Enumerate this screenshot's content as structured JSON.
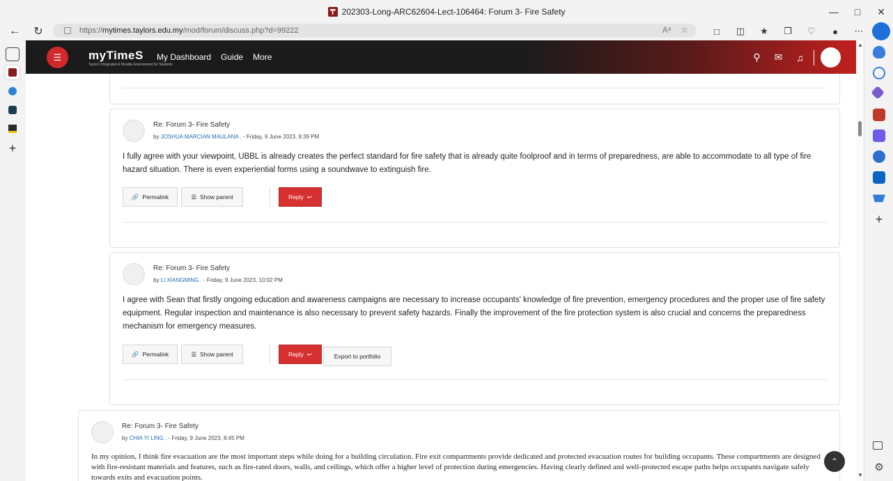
{
  "window": {
    "title": "202303-Long-ARC62604-Lect-106464: Forum 3- Fire Safety",
    "url_prefix": "https://",
    "url_host": "mytimes.taylors.edu.my",
    "url_path": "/mod/forum/discuss.php?d=99222"
  },
  "header": {
    "logo": "myTimeS",
    "logo_sub": "Taylor's Integrated & Moodle Environment for Students",
    "nav": [
      "My Dashboard",
      "Guide",
      "More"
    ]
  },
  "posts": [
    {
      "subject": "Re: Forum 3- Fire Safety",
      "by": "by",
      "author": "JOSHUA MARCIAN MAULANA",
      "date": " . - Friday, 9 June 2023, 9:39 PM",
      "content": "I fully agree with your viewpoint, UBBL is already creates the perfect standard for fire safety that is already quite foolproof and in terms of preparedness, are able to accommodate to all type of fire hazard situation. There is even experiential forms using a soundwave to extinguish fire.",
      "permalink": "Permalink",
      "show_parent": "Show parent",
      "reply": "Reply"
    },
    {
      "subject": "Re: Forum 3- Fire Safety",
      "by": "by",
      "author": "LI XIANGMING",
      "date": " . - Friday, 9 June 2023, 10:02 PM",
      "content": "I agree with Sean that firstly ongoing education and awareness campaigns are necessary to increase occupants' knowledge of fire prevention, emergency procedures and the proper use of fire safety equipment. Regular inspection and maintenance is also necessary to prevent safety hazards. Finally the improvement of the fire protection system is also crucial and concerns the preparedness mechanism for emergency measures.",
      "permalink": "Permalink",
      "show_parent": "Show parent",
      "reply": "Reply",
      "export": "Export to portfolio"
    },
    {
      "subject": "Re: Forum 3- Fire Safety",
      "by": "by",
      "author": "CHIA YI LING",
      "date": " . - Friday, 9 June 2023, 8:45 PM",
      "content": "In my opinion, I think fire evacuation are the most important steps while doing for a building circulation. Fire exit compartments provide dedicated and protected evacuation routes for building occupants. These compartments are designed with fire-resistant materials and features, such as fire-rated doors, walls, and ceilings, which offer a higher level of protection during emergencies. Having clearly defined and well-protected escape paths helps occupants navigate safely towards exits and evacuation points."
    }
  ]
}
